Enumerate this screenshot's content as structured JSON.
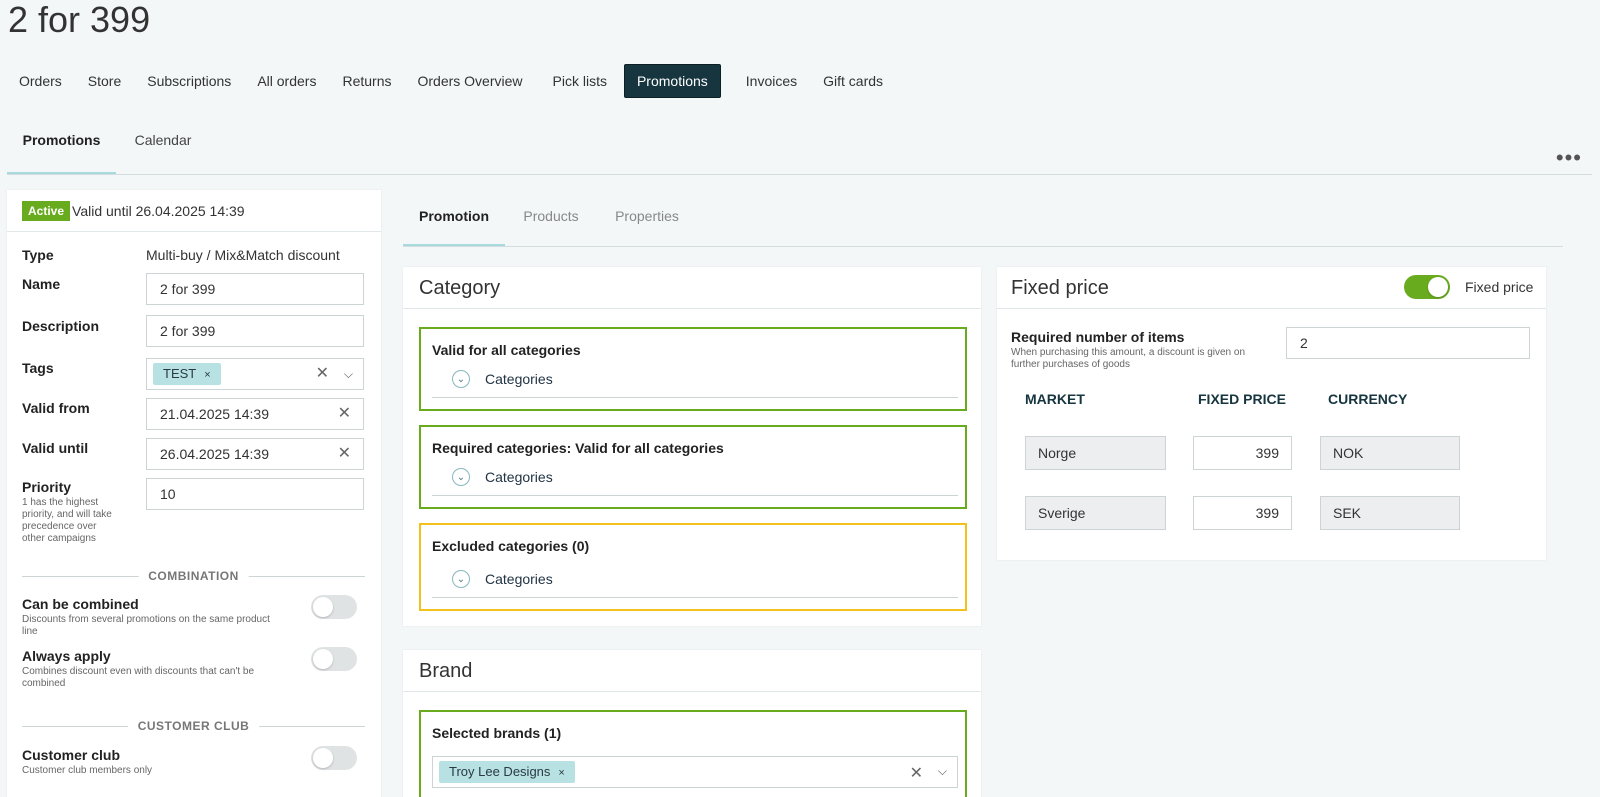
{
  "page": {
    "title": "2 for 399"
  },
  "main_nav": [
    {
      "label": "Orders"
    },
    {
      "label": "Store"
    },
    {
      "label": "Subscriptions"
    },
    {
      "label": "All orders"
    },
    {
      "label": "Returns"
    },
    {
      "label": "Orders Overview"
    },
    {
      "label": "Pick lists"
    },
    {
      "label": "Promotions",
      "active": true
    },
    {
      "label": "Invoices"
    },
    {
      "label": "Gift cards"
    }
  ],
  "sub_tabs": [
    {
      "label": "Promotions",
      "active": true
    },
    {
      "label": "Calendar"
    }
  ],
  "more_menu": "•••",
  "status": {
    "badge": "Active",
    "text": "Valid until 26.04.2025 14:39"
  },
  "form": {
    "type_label": "Type",
    "type_value": "Multi-buy / Mix&Match discount",
    "name_label": "Name",
    "name_value": "2 for 399",
    "description_label": "Description",
    "description_value": "2 for 399",
    "tags_label": "Tags",
    "tags": [
      "TEST"
    ],
    "valid_from_label": "Valid from",
    "valid_from_value": "21.04.2025 14:39",
    "valid_until_label": "Valid until",
    "valid_until_value": "26.04.2025 14:39",
    "priority_label": "Priority",
    "priority_hint": "1 has the highest priority, and will take precedence over other campaigns",
    "priority_value": "10"
  },
  "combination": {
    "heading": "COMBINATION",
    "can_be_combined_label": "Can be combined",
    "can_be_combined_hint": "Discounts from several promotions on the same product line",
    "can_be_combined": false,
    "always_apply_label": "Always apply",
    "always_apply_hint": "Combines discount even with discounts that can't be combined",
    "always_apply": false
  },
  "customer_club": {
    "heading": "CUSTOMER CLUB",
    "label": "Customer club",
    "hint": "Customer club members only",
    "enabled": false
  },
  "detail_tabs": [
    {
      "label": "Promotion",
      "active": true
    },
    {
      "label": "Products"
    },
    {
      "label": "Properties"
    }
  ],
  "category_card": {
    "title": "Category",
    "boxes": [
      {
        "title": "Valid for all categories",
        "link": "Categories",
        "color": "#69ab1e"
      },
      {
        "title": "Required categories: Valid for all categories",
        "link": "Categories",
        "color": "#69ab1e"
      },
      {
        "title": "Excluded categories (0)",
        "link": "Categories",
        "color": "#f3c11b"
      }
    ]
  },
  "brand_card": {
    "title": "Brand",
    "selected_title": "Selected brands (1)",
    "brands": [
      "Troy Lee Designs"
    ]
  },
  "fixed_price_card": {
    "title": "Fixed price",
    "toggle_label": "Fixed price",
    "toggle_on": true,
    "required_label": "Required number of items",
    "required_hint": "When purchasing this amount, a discount is given on further purchases of goods",
    "required_value": "2",
    "columns": [
      "MARKET",
      "FIXED PRICE",
      "CURRENCY"
    ],
    "rows": [
      {
        "market": "Norge",
        "price": "399",
        "currency": "NOK"
      },
      {
        "market": "Sverige",
        "price": "399",
        "currency": "SEK"
      }
    ]
  },
  "icons": {
    "clear": "✕",
    "chevron_down": "⌵",
    "chip_remove": "×",
    "expand": "⌄"
  },
  "colors": {
    "nav_active_bg": "#16353f",
    "active_badge": "#69ab1e",
    "box_green": "#69ab1e",
    "box_yellow": "#f3c11b",
    "tab_underline": "#a6dadd",
    "chip_bg": "#b7e1e3"
  }
}
